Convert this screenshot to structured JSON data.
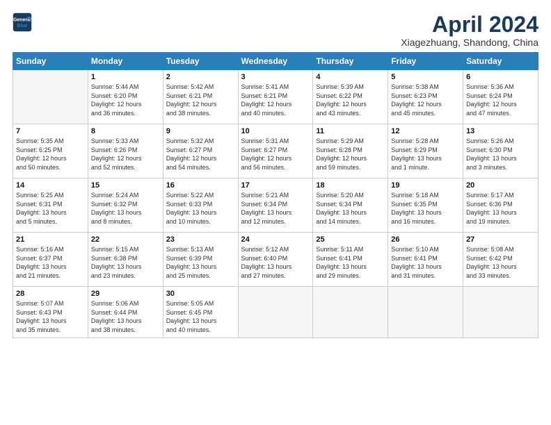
{
  "logo": {
    "line1": "General",
    "line2": "Blue"
  },
  "title": "April 2024",
  "location": "Xiagezhuang, Shandong, China",
  "weekdays": [
    "Sunday",
    "Monday",
    "Tuesday",
    "Wednesday",
    "Thursday",
    "Friday",
    "Saturday"
  ],
  "weeks": [
    [
      {
        "day": "",
        "info": ""
      },
      {
        "day": "1",
        "info": "Sunrise: 5:44 AM\nSunset: 6:20 PM\nDaylight: 12 hours\nand 36 minutes."
      },
      {
        "day": "2",
        "info": "Sunrise: 5:42 AM\nSunset: 6:21 PM\nDaylight: 12 hours\nand 38 minutes."
      },
      {
        "day": "3",
        "info": "Sunrise: 5:41 AM\nSunset: 6:21 PM\nDaylight: 12 hours\nand 40 minutes."
      },
      {
        "day": "4",
        "info": "Sunrise: 5:39 AM\nSunset: 6:22 PM\nDaylight: 12 hours\nand 43 minutes."
      },
      {
        "day": "5",
        "info": "Sunrise: 5:38 AM\nSunset: 6:23 PM\nDaylight: 12 hours\nand 45 minutes."
      },
      {
        "day": "6",
        "info": "Sunrise: 5:36 AM\nSunset: 6:24 PM\nDaylight: 12 hours\nand 47 minutes."
      }
    ],
    [
      {
        "day": "7",
        "info": "Sunrise: 5:35 AM\nSunset: 6:25 PM\nDaylight: 12 hours\nand 50 minutes."
      },
      {
        "day": "8",
        "info": "Sunrise: 5:33 AM\nSunset: 6:26 PM\nDaylight: 12 hours\nand 52 minutes."
      },
      {
        "day": "9",
        "info": "Sunrise: 5:32 AM\nSunset: 6:27 PM\nDaylight: 12 hours\nand 54 minutes."
      },
      {
        "day": "10",
        "info": "Sunrise: 5:31 AM\nSunset: 6:27 PM\nDaylight: 12 hours\nand 56 minutes."
      },
      {
        "day": "11",
        "info": "Sunrise: 5:29 AM\nSunset: 6:28 PM\nDaylight: 12 hours\nand 59 minutes."
      },
      {
        "day": "12",
        "info": "Sunrise: 5:28 AM\nSunset: 6:29 PM\nDaylight: 13 hours\nand 1 minute."
      },
      {
        "day": "13",
        "info": "Sunrise: 5:26 AM\nSunset: 6:30 PM\nDaylight: 13 hours\nand 3 minutes."
      }
    ],
    [
      {
        "day": "14",
        "info": "Sunrise: 5:25 AM\nSunset: 6:31 PM\nDaylight: 13 hours\nand 5 minutes."
      },
      {
        "day": "15",
        "info": "Sunrise: 5:24 AM\nSunset: 6:32 PM\nDaylight: 13 hours\nand 8 minutes."
      },
      {
        "day": "16",
        "info": "Sunrise: 5:22 AM\nSunset: 6:33 PM\nDaylight: 13 hours\nand 10 minutes."
      },
      {
        "day": "17",
        "info": "Sunrise: 5:21 AM\nSunset: 6:34 PM\nDaylight: 13 hours\nand 12 minutes."
      },
      {
        "day": "18",
        "info": "Sunrise: 5:20 AM\nSunset: 6:34 PM\nDaylight: 13 hours\nand 14 minutes."
      },
      {
        "day": "19",
        "info": "Sunrise: 5:18 AM\nSunset: 6:35 PM\nDaylight: 13 hours\nand 16 minutes."
      },
      {
        "day": "20",
        "info": "Sunrise: 5:17 AM\nSunset: 6:36 PM\nDaylight: 13 hours\nand 19 minutes."
      }
    ],
    [
      {
        "day": "21",
        "info": "Sunrise: 5:16 AM\nSunset: 6:37 PM\nDaylight: 13 hours\nand 21 minutes."
      },
      {
        "day": "22",
        "info": "Sunrise: 5:15 AM\nSunset: 6:38 PM\nDaylight: 13 hours\nand 23 minutes."
      },
      {
        "day": "23",
        "info": "Sunrise: 5:13 AM\nSunset: 6:39 PM\nDaylight: 13 hours\nand 25 minutes."
      },
      {
        "day": "24",
        "info": "Sunrise: 5:12 AM\nSunset: 6:40 PM\nDaylight: 13 hours\nand 27 minutes."
      },
      {
        "day": "25",
        "info": "Sunrise: 5:11 AM\nSunset: 6:41 PM\nDaylight: 13 hours\nand 29 minutes."
      },
      {
        "day": "26",
        "info": "Sunrise: 5:10 AM\nSunset: 6:41 PM\nDaylight: 13 hours\nand 31 minutes."
      },
      {
        "day": "27",
        "info": "Sunrise: 5:08 AM\nSunset: 6:42 PM\nDaylight: 13 hours\nand 33 minutes."
      }
    ],
    [
      {
        "day": "28",
        "info": "Sunrise: 5:07 AM\nSunset: 6:43 PM\nDaylight: 13 hours\nand 35 minutes."
      },
      {
        "day": "29",
        "info": "Sunrise: 5:06 AM\nSunset: 6:44 PM\nDaylight: 13 hours\nand 38 minutes."
      },
      {
        "day": "30",
        "info": "Sunrise: 5:05 AM\nSunset: 6:45 PM\nDaylight: 13 hours\nand 40 minutes."
      },
      {
        "day": "",
        "info": ""
      },
      {
        "day": "",
        "info": ""
      },
      {
        "day": "",
        "info": ""
      },
      {
        "day": "",
        "info": ""
      }
    ]
  ]
}
